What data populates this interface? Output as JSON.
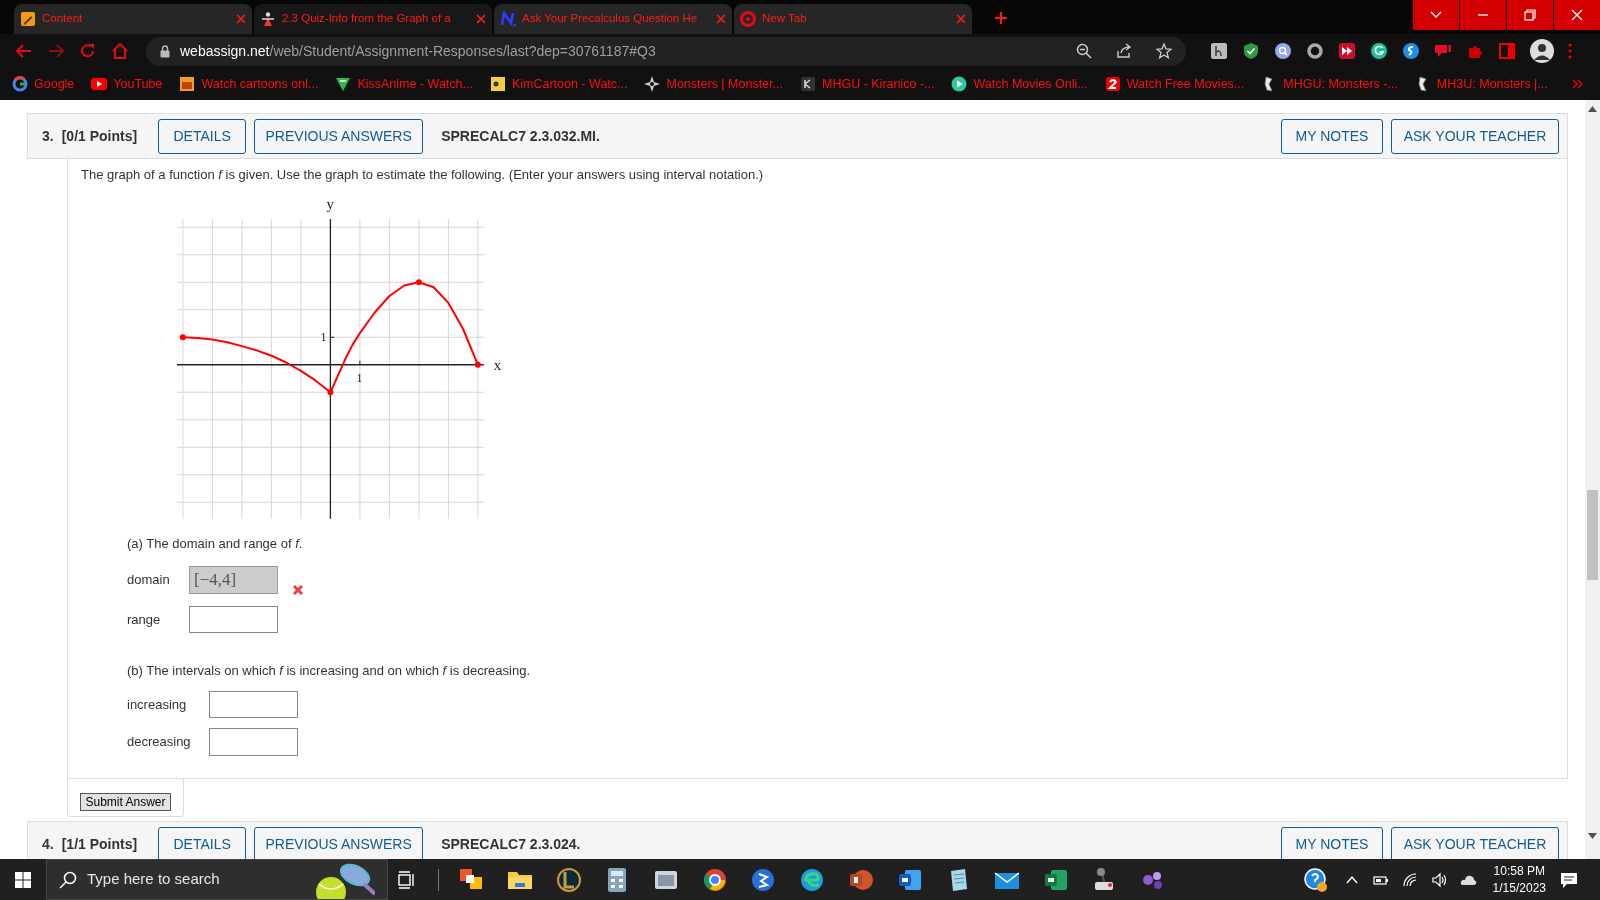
{
  "browser": {
    "tabs": [
      {
        "title": "Content",
        "selected": false
      },
      {
        "title": "2.3 Quiz-Info from the Graph of a",
        "selected": true
      },
      {
        "title": "Ask Your Precalculus Question He",
        "selected": false
      },
      {
        "title": "New Tab",
        "selected": false
      }
    ],
    "url": {
      "host": "webassign.net",
      "path": "/web/Student/Assignment-Responses/last?dep=30761187#Q3"
    },
    "bookmarks": [
      {
        "label": "Google"
      },
      {
        "label": "YouTube"
      },
      {
        "label": "Watch cartoons onl..."
      },
      {
        "label": "KissAnime - Watch..."
      },
      {
        "label": "KimCartoon - Watc..."
      },
      {
        "label": "Monsters | Monster..."
      },
      {
        "label": "MHGU - Kiranico -..."
      },
      {
        "label": "Watch Movies Onli..."
      },
      {
        "label": "Watch Free Movies..."
      },
      {
        "label": "MHGU: Monsters -..."
      },
      {
        "label": "MH3U: Monsters |..."
      }
    ]
  },
  "question": {
    "number": "3.",
    "points": "[0/1 Points]",
    "buttons": [
      "DETAILS",
      "PREVIOUS ANSWERS"
    ],
    "code": "SPRECALC7 2.3.032.MI.",
    "right_buttons": [
      "MY NOTES",
      "ASK YOUR TEACHER"
    ],
    "prompt": "The graph of a function *f* is given. Use the graph to estimate the following. (Enter your answers using interval notation.)",
    "graph": {
      "x_label": "x",
      "y_label": "y",
      "x_tick": "1",
      "y_tick": "1"
    },
    "parts": [
      {
        "heading": "(a) The domain and range of *f*.",
        "fields": [
          {
            "label": "domain",
            "value": "[−4,4]",
            "incorrect": true
          },
          {
            "label": "range",
            "incorrect": false
          }
        ]
      },
      {
        "heading": "(b) The intervals on which *f* is increasing and on which *f* is decreasing.",
        "fields": [
          {
            "label": "increasing",
            "incorrect": false
          },
          {
            "label": "decreasing",
            "incorrect": false
          }
        ]
      }
    ],
    "submit": "Submit Answer"
  },
  "next_question": {
    "number": "4.",
    "points": "[1/1 Points]",
    "buttons": [
      "DETAILS",
      "PREVIOUS ANSWERS"
    ],
    "code": "SPRECALC7 2.3.024.",
    "right_buttons": [
      "MY NOTES",
      "ASK YOUR TEACHER"
    ]
  },
  "taskbar": {
    "search_placeholder": "Type here to search",
    "time": "10:58 PM",
    "date": "1/15/2023"
  }
}
